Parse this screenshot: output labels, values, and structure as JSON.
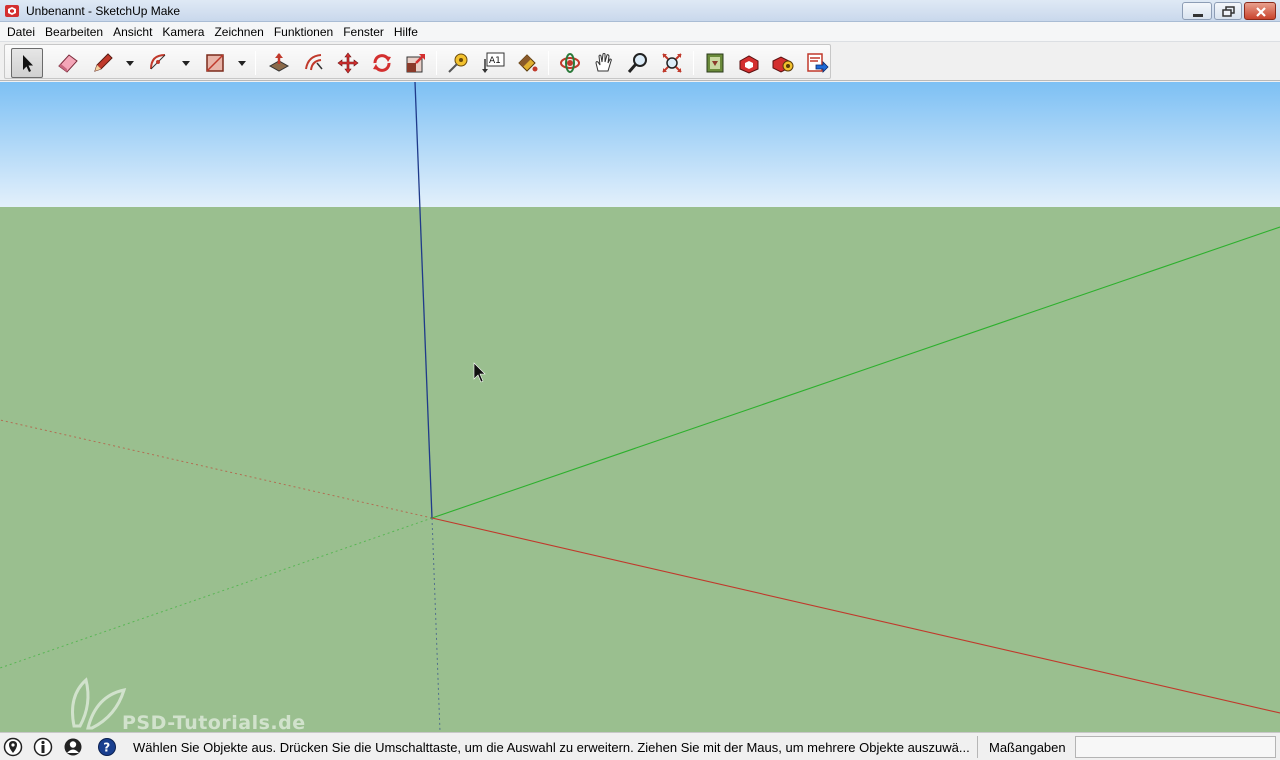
{
  "window": {
    "title": "Unbenannt - SketchUp Make"
  },
  "menubar": {
    "items": [
      "Datei",
      "Bearbeiten",
      "Ansicht",
      "Kamera",
      "Zeichnen",
      "Funktionen",
      "Fenster",
      "Hilfe"
    ]
  },
  "toolbar": {
    "tools": [
      {
        "name": "select-tool",
        "icon": "arrow-cursor-icon",
        "active": true
      },
      {
        "name": "eraser-tool",
        "icon": "eraser-icon"
      },
      {
        "name": "line-tool",
        "icon": "pencil-icon",
        "has_dropdown": true
      },
      {
        "name": "arc-tool",
        "icon": "arc-icon",
        "has_dropdown": true
      },
      {
        "name": "rectangle-tool",
        "icon": "rectangle-icon",
        "has_dropdown": true
      },
      {
        "name": "push-pull-tool",
        "icon": "push-pull-icon"
      },
      {
        "name": "offset-tool",
        "icon": "offset-icon"
      },
      {
        "name": "move-tool",
        "icon": "move-icon"
      },
      {
        "name": "rotate-tool",
        "icon": "rotate-icon"
      },
      {
        "name": "scale-tool",
        "icon": "scale-icon"
      },
      {
        "name": "tape-measure-tool",
        "icon": "tape-measure-icon"
      },
      {
        "name": "text-tool",
        "icon": "text-label-icon"
      },
      {
        "name": "paint-bucket-tool",
        "icon": "paint-bucket-icon"
      },
      {
        "name": "orbit-tool",
        "icon": "orbit-icon"
      },
      {
        "name": "pan-tool",
        "icon": "hand-icon"
      },
      {
        "name": "zoom-tool",
        "icon": "magnifier-icon"
      },
      {
        "name": "zoom-extents-tool",
        "icon": "zoom-extents-icon"
      },
      {
        "name": "warehouse-tool",
        "icon": "warehouse-icon"
      },
      {
        "name": "share-model-tool",
        "icon": "share-model-icon"
      },
      {
        "name": "extension-warehouse-tool",
        "icon": "extension-warehouse-icon"
      },
      {
        "name": "layout-send-tool",
        "icon": "send-to-layout-icon"
      }
    ],
    "text_tool_label": "A1"
  },
  "viewport": {
    "colors": {
      "sky_top": "#7dc0f4",
      "sky_bottom": "#e3f0fb",
      "ground": "#9abf8f",
      "axis_blue": "#1f3a8a",
      "axis_green": "#2db02d",
      "axis_red": "#c0392b"
    }
  },
  "watermark": {
    "text": "PSD-Tutorials.de"
  },
  "statusbar": {
    "message": "Wählen Sie Objekte aus. Drücken Sie die Umschalttaste, um die Auswahl zu erweitern. Ziehen Sie mit der Maus, um mehrere Objekte auszuwä...",
    "measure_label": "Maßangaben",
    "measure_value": ""
  }
}
